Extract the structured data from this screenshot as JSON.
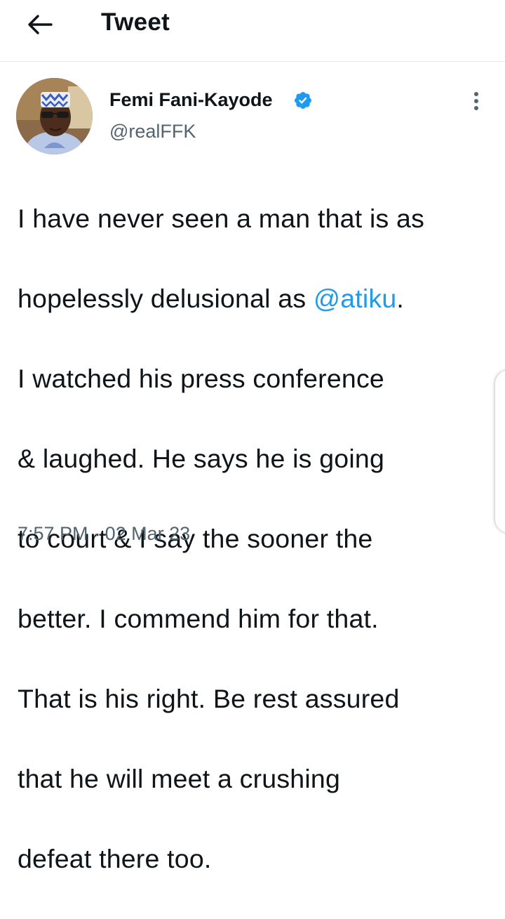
{
  "header": {
    "back_icon": "arrow-left-icon",
    "title": "Tweet"
  },
  "tweet": {
    "author_name": "Femi Fani-Kayode",
    "verified_icon": "verified-badge-icon",
    "handle": "@realFFK",
    "more_icon": "more-vertical-icon",
    "text_lines": [
      "I have never seen a man that is as",
      "hopelessly delusional as ",
      "@atiku",
      ".",
      "I watched his press conference",
      "& laughed. He says he is going",
      "to court & I say the sooner the",
      "better. I commend him for that.",
      "That is his right. Be rest assured",
      "that he will meet a crushing",
      "defeat there too."
    ],
    "time": "7:57 PM",
    "separator": "·",
    "date": "02 Mar 23"
  },
  "colors": {
    "accent": "#1d9bf0",
    "text": "#0f1419",
    "secondary": "#536471",
    "divider": "#e7e9ea"
  }
}
